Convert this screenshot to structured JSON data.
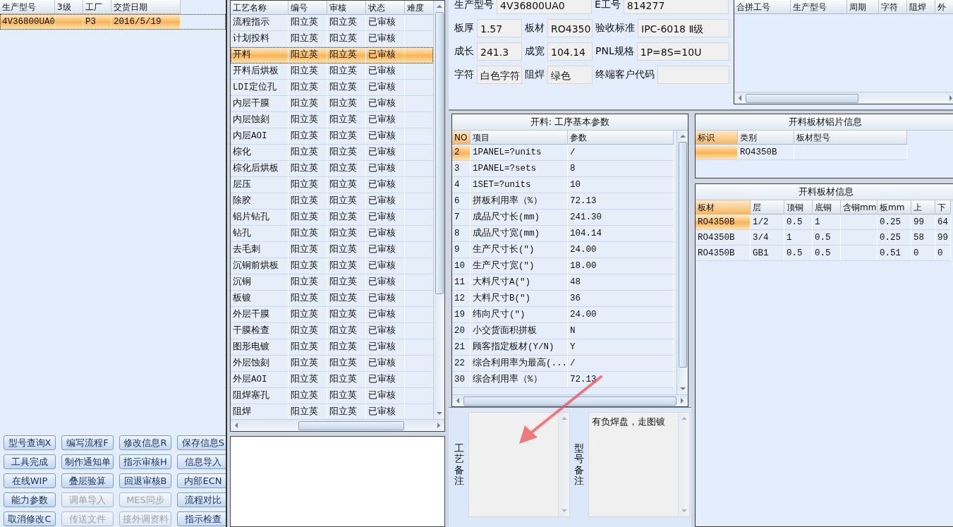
{
  "left_table": {
    "columns": [
      "生产型号",
      "3级",
      "工厂",
      "交货日期"
    ],
    "rows": [
      {
        "cells": [
          "4V36800UA0",
          null,
          "P3",
          "2016/5/19"
        ],
        "selected": true
      }
    ]
  },
  "buttons": [
    {
      "label": "型号查询X",
      "disabled": false
    },
    {
      "label": "编写流程F",
      "disabled": false
    },
    {
      "label": "修改信息R",
      "disabled": false
    },
    {
      "label": "保存信息S",
      "disabled": false
    },
    {
      "label": "工具完成",
      "disabled": false
    },
    {
      "label": "制作通知单",
      "disabled": false
    },
    {
      "label": "指示审核H",
      "disabled": false
    },
    {
      "label": "信息导入",
      "disabled": false
    },
    {
      "label": "在线WIP",
      "disabled": false
    },
    {
      "label": "叠层验算",
      "disabled": false
    },
    {
      "label": "回退审核B",
      "disabled": false
    },
    {
      "label": "内部ECN",
      "disabled": false
    },
    {
      "label": "能力参数",
      "disabled": false
    },
    {
      "label": "调单导入",
      "disabled": true
    },
    {
      "label": "MES同步",
      "disabled": true
    },
    {
      "label": "流程对比",
      "disabled": false
    },
    {
      "label": "取消修改C",
      "disabled": false
    },
    {
      "label": "传送文件",
      "disabled": true
    },
    {
      "label": "接外调资料",
      "disabled": true
    },
    {
      "label": "指示检查",
      "disabled": false
    }
  ],
  "process_table": {
    "columns": [
      "工艺名称",
      "编号",
      "审核",
      "状态",
      "难度"
    ],
    "rows": [
      {
        "cells": [
          "流程指示",
          "阳立英",
          "阳立英",
          "已审核"
        ],
        "selected": false
      },
      {
        "cells": [
          "计划投料",
          "阳立英",
          "阳立英",
          "已审核"
        ],
        "selected": false
      },
      {
        "cells": [
          "开料",
          "阳立英",
          "阳立英",
          "已审核"
        ],
        "selected": true
      },
      {
        "cells": [
          "开料后烘板",
          "阳立英",
          "阳立英",
          "已审核"
        ],
        "selected": false
      },
      {
        "cells": [
          "LDI定位孔",
          "阳立英",
          "阳立英",
          "已审核"
        ],
        "selected": false
      },
      {
        "cells": [
          "内层干膜",
          "阳立英",
          "阳立英",
          "已审核"
        ],
        "selected": false
      },
      {
        "cells": [
          "内层蚀刻",
          "阳立英",
          "阳立英",
          "已审核"
        ],
        "selected": false
      },
      {
        "cells": [
          "内层AOI",
          "阳立英",
          "阳立英",
          "已审核"
        ],
        "selected": false
      },
      {
        "cells": [
          "棕化",
          "阳立英",
          "阳立英",
          "已审核"
        ],
        "selected": false
      },
      {
        "cells": [
          "棕化后烘板",
          "阳立英",
          "阳立英",
          "已审核"
        ],
        "selected": false
      },
      {
        "cells": [
          "层压",
          "阳立英",
          "阳立英",
          "已审核"
        ],
        "selected": false
      },
      {
        "cells": [
          "除胶",
          "阳立英",
          "阳立英",
          "已审核"
        ],
        "selected": false
      },
      {
        "cells": [
          "铝片钻孔",
          "阳立英",
          "阳立英",
          "已审核"
        ],
        "selected": false
      },
      {
        "cells": [
          "钻孔",
          "阳立英",
          "阳立英",
          "已审核"
        ],
        "selected": false
      },
      {
        "cells": [
          "去毛刺",
          "阳立英",
          "阳立英",
          "已审核"
        ],
        "selected": false
      },
      {
        "cells": [
          "沉铜前烘板",
          "阳立英",
          "阳立英",
          "已审核"
        ],
        "selected": false
      },
      {
        "cells": [
          "沉铜",
          "阳立英",
          "阳立英",
          "已审核"
        ],
        "selected": false
      },
      {
        "cells": [
          "板镀",
          "阳立英",
          "阳立英",
          "已审核"
        ],
        "selected": false
      },
      {
        "cells": [
          "外层干膜",
          "阳立英",
          "阳立英",
          "已审核"
        ],
        "selected": false
      },
      {
        "cells": [
          "干膜检查",
          "阳立英",
          "阳立英",
          "已审核"
        ],
        "selected": false
      },
      {
        "cells": [
          "图形电镀",
          "阳立英",
          "阳立英",
          "已审核"
        ],
        "selected": false
      },
      {
        "cells": [
          "外层蚀刻",
          "阳立英",
          "阳立英",
          "已审核"
        ],
        "selected": false
      },
      {
        "cells": [
          "外层AOI",
          "阳立英",
          "阳立英",
          "已审核"
        ],
        "selected": false
      },
      {
        "cells": [
          "阻焊塞孔",
          "阳立英",
          "阳立英",
          "已审核"
        ],
        "selected": false
      },
      {
        "cells": [
          "阻焊",
          "阳立英",
          "阳立英",
          "已审核"
        ],
        "selected": false
      }
    ]
  },
  "product_form": {
    "fields": [
      {
        "label": "生产型号",
        "value": "4V36800UA0"
      },
      {
        "label": "E工号",
        "value": "814277"
      },
      {
        "label": "板厚",
        "value": "1.57"
      },
      {
        "label": "板材",
        "value": "RO4350"
      },
      {
        "label": "验收标准",
        "value": "IPC-6018 Ⅱ级"
      },
      {
        "label": "成长",
        "value": "241.3"
      },
      {
        "label": "成宽",
        "value": "104.14"
      },
      {
        "label": "PNL规格",
        "value": "1P=8S=10U"
      },
      {
        "label": "字符",
        "value": "白色字符"
      },
      {
        "label": "阻焊",
        "value": "绿色"
      },
      {
        "label": "终端客户代码"
      }
    ]
  },
  "merge_table": {
    "columns": [
      "合拼工号",
      "生产型号",
      "周期",
      "字符",
      "阻焊",
      "外"
    ]
  },
  "params_panel": {
    "title": "开料: 工序基本参数",
    "columns": [
      "NO",
      "项目",
      "参数"
    ],
    "rows": [
      {
        "no": "2",
        "item": "1PANEL=?units",
        "value": "/",
        "selected": true
      },
      {
        "no": "3",
        "item": "1PANEL=?sets",
        "value": "8",
        "selected": false
      },
      {
        "no": "4",
        "item": "1SET=?units",
        "value": "10",
        "selected": false
      },
      {
        "no": "6",
        "item": "拼板利用率（%）",
        "value": "72.13",
        "selected": false
      },
      {
        "no": "7",
        "item": "成品尺寸长(mm)",
        "value": "241.30",
        "selected": false
      },
      {
        "no": "8",
        "item": "成品尺寸宽(mm)",
        "value": "104.14",
        "selected": false
      },
      {
        "no": "9",
        "item": "生产尺寸长(\")",
        "value": "24.00",
        "selected": false
      },
      {
        "no": "10",
        "item": "生产尺寸宽(\")",
        "value": "18.00",
        "selected": false
      },
      {
        "no": "11",
        "item": "大料尺寸A(\")",
        "value": "48",
        "selected": false
      },
      {
        "no": "12",
        "item": "大料尺寸B(\")",
        "value": "36",
        "selected": false
      },
      {
        "no": "19",
        "item": "纬向尺寸(\")",
        "value": "24.00",
        "selected": false
      },
      {
        "no": "20",
        "item": "小交货面积拼板",
        "value": "N",
        "selected": false
      },
      {
        "no": "21",
        "item": "顾客指定板材(Y/N)",
        "value": "Y",
        "selected": false
      },
      {
        "no": "22",
        "item": "综合利用率为最高(...",
        "value": "/",
        "selected": false
      },
      {
        "no": "30",
        "item": "综合利用率（%）",
        "value": "72.13",
        "selected": false
      }
    ]
  },
  "notes": [
    {
      "label": "工艺备注"
    },
    {
      "label": "型号备注",
      "value": "有负焊盘，走图镀"
    }
  ],
  "foil_panel": {
    "title": "开料板材铝片信息",
    "columns": [
      "标识",
      "类别",
      "板材型号"
    ],
    "rows": [
      {
        "cells": [
          null,
          "RO4350B",
          null
        ],
        "selected": true
      }
    ]
  },
  "board_panel": {
    "title": "开料板材信息",
    "columns": [
      "板材",
      "层",
      "顶铜",
      "底铜",
      "含铜mm",
      "板mm",
      "上",
      "下"
    ],
    "rows": [
      {
        "cells": [
          "RO4350B",
          "1/2",
          "0.5",
          "1",
          null,
          "0.25",
          "99",
          "64"
        ],
        "selected": true
      },
      {
        "cells": [
          "RO4350B",
          "3/4",
          "1",
          "0.5",
          null,
          "0.25",
          "58",
          "99"
        ],
        "selected": false
      },
      {
        "cells": [
          "RO4350B",
          "GB1",
          "0.5",
          "0.5",
          null,
          "0.51",
          "0",
          "0"
        ],
        "selected": false
      }
    ]
  }
}
